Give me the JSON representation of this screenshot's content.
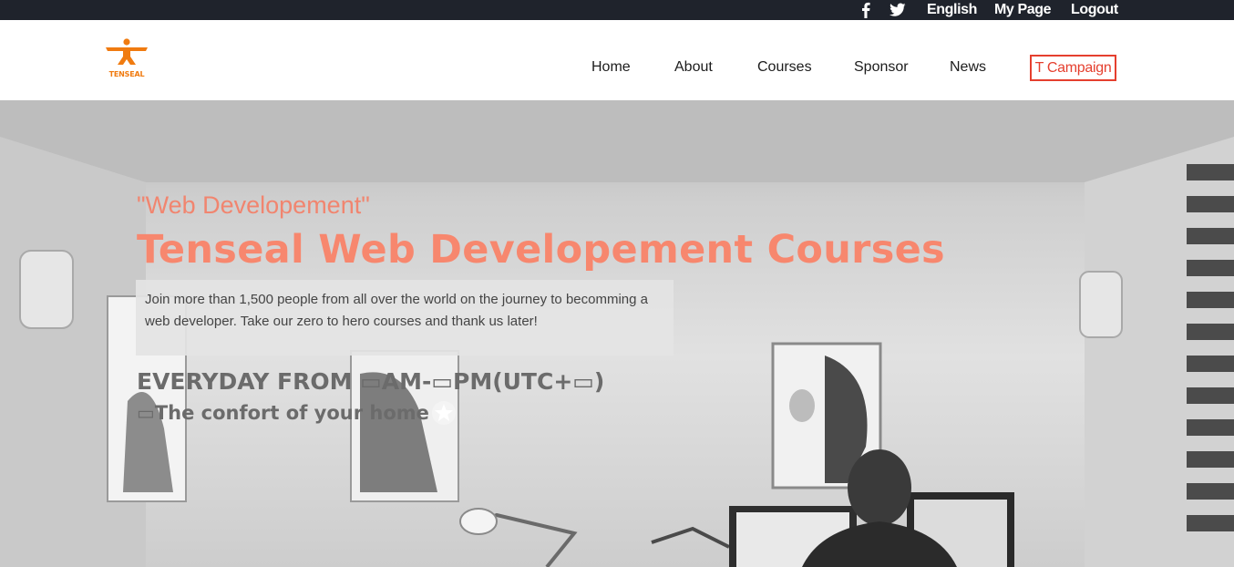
{
  "topbar": {
    "social": [
      {
        "icon": "facebook-icon"
      },
      {
        "icon": "twitter-icon"
      }
    ],
    "language": "English",
    "my_page": "My Page",
    "logout": "Logout"
  },
  "header": {
    "logo_text": "TENSEAL",
    "logo_color": "#f07b10",
    "nav": {
      "home": "Home",
      "about": "About",
      "courses": "Courses",
      "sponsor": "Sponsor",
      "news": "News",
      "campaign": "T Campaign"
    },
    "campaign_color": "#e53f2e"
  },
  "hero": {
    "subtitle": "\"Web Developement\"",
    "title": "Tenseal Web Developement Courses",
    "description": "Join more than 1,500 people from all over the world on the journey to becomming a web developer. Take our zero to hero courses and thank us later!",
    "schedule": "EVERYDAY FROM ▭AM-▭PM(UTC+▭)",
    "comfort": "▭The confort of your home",
    "accent_color": "#f7876e"
  }
}
